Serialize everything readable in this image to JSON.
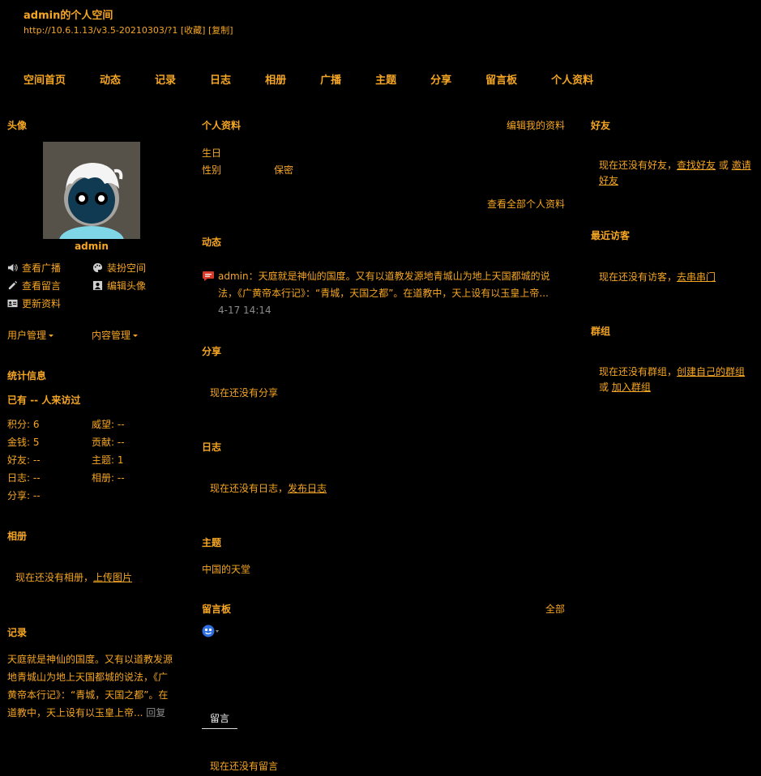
{
  "header": {
    "title": "admin的个人空间",
    "url": "http://10.6.1.13/v3.5-20210303/?1",
    "favorite": "[收藏]",
    "copy": "[复制]"
  },
  "nav": [
    "空间首页",
    "动态",
    "记录",
    "日志",
    "相册",
    "广播",
    "主题",
    "分享",
    "留言板",
    "个人资料"
  ],
  "left": {
    "avatar_header": "头像",
    "username": "admin",
    "actions": {
      "view_broadcast": "查看广播",
      "dress_space": "装扮空间",
      "view_comments": "查看留言",
      "edit_avatar": "编辑头像",
      "update_profile": "更新资料"
    },
    "menus": {
      "user_manage": "用户管理",
      "content_manage": "内容管理"
    },
    "stats": {
      "header": "统计信息",
      "visitors_prefix": "已有",
      "visitors_value": "--",
      "visitors_suffix": "人来访过",
      "items": [
        {
          "label": "积分:",
          "value": "6"
        },
        {
          "label": "威望:",
          "value": "--"
        },
        {
          "label": "金钱:",
          "value": "5"
        },
        {
          "label": "贡献:",
          "value": "--"
        },
        {
          "label": "好友:",
          "value": "--"
        },
        {
          "label": "主题:",
          "value": "1"
        },
        {
          "label": "日志:",
          "value": "--"
        },
        {
          "label": "相册:",
          "value": "--"
        },
        {
          "label": "分享:",
          "value": "--"
        }
      ]
    },
    "album": {
      "header": "相册",
      "empty": "现在还没有相册，",
      "link": "上传图片"
    },
    "record": {
      "header": "记录",
      "text": "天庭就是神仙的国度。又有以道教发源地青城山为地上天国都城的说法，《广黄帝本行记》：“青城，天国之都”。在道教中，天上设有以玉皇上帝...",
      "reply": "回复"
    }
  },
  "center": {
    "profile": {
      "header": "个人资料",
      "edit": "编辑我的资料",
      "birthday_label": "生日",
      "gender_label": "性别",
      "gender_value": "保密",
      "view_all": "查看全部个人资料"
    },
    "feed": {
      "header": "动态",
      "author": "admin",
      "text": "：天庭就是神仙的国度。又有以道教发源地青城山为地上天国都城的说法，《广黄帝本行记》：“青城，天国之都”。在道教中，天上设有以玉皇上帝...",
      "time": "4-17 14:14"
    },
    "share": {
      "header": "分享",
      "empty": "现在还没有分享"
    },
    "blog": {
      "header": "日志",
      "empty": "现在还没有日志，",
      "link": "发布日志"
    },
    "topic": {
      "header": "主题",
      "item": "中国的天堂"
    },
    "guestbook": {
      "header": "留言板",
      "all": "全部",
      "tab": "留言",
      "empty": "现在还没有留言"
    }
  },
  "right": {
    "friends": {
      "header": "好友",
      "text": "现在还没有好友，",
      "find": "查找好友",
      "or": "或",
      "invite": "邀请好友"
    },
    "visitors": {
      "header": "最近访客",
      "text": "现在还没有访客，",
      "link": "去串串门"
    },
    "groups": {
      "header": "群组",
      "text": "现在还没有群组，",
      "create": "创建自己的群组",
      "or": "或",
      "join": "加入群组"
    }
  },
  "colors": {
    "background": "#000000",
    "text": "#f5a623",
    "muted": "#8a8a8a"
  }
}
